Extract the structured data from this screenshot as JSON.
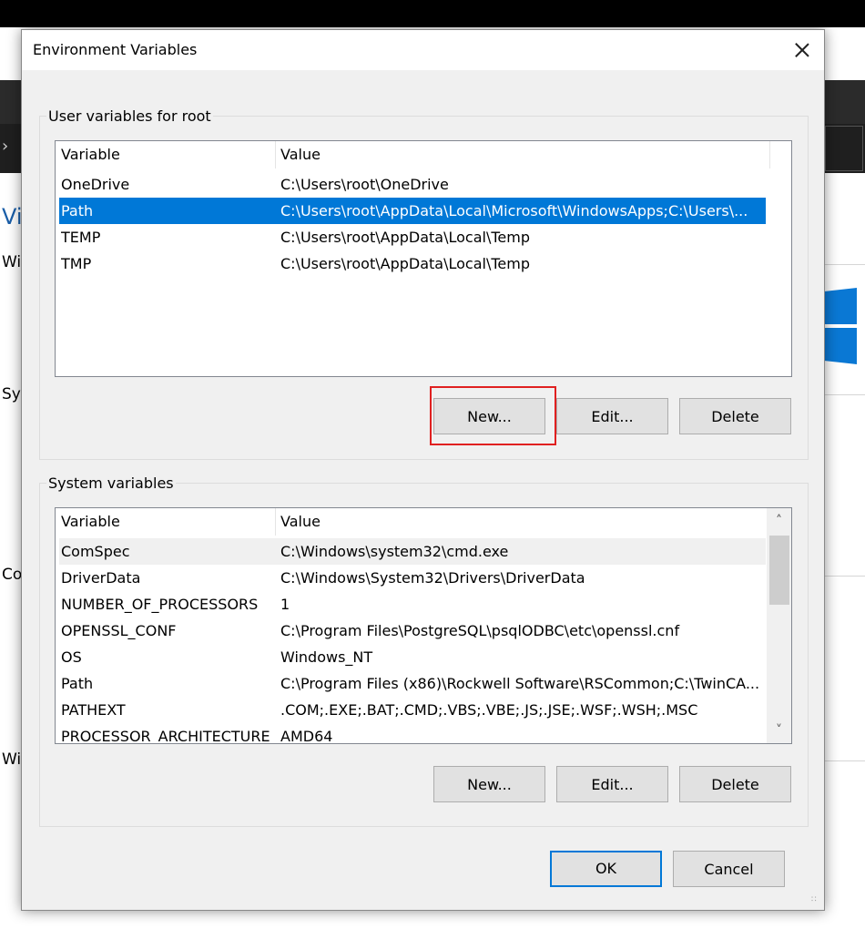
{
  "background": {
    "fragments": [
      "Vi",
      "Wi",
      "Sys",
      "Co",
      "Wi"
    ]
  },
  "dialog": {
    "title": "Environment Variables",
    "user_group": {
      "label": "User variables for root",
      "columns": [
        "Variable",
        "Value"
      ],
      "rows": [
        {
          "variable": "OneDrive",
          "value": "C:\\Users\\root\\OneDrive"
        },
        {
          "variable": "Path",
          "value": "C:\\Users\\root\\AppData\\Local\\Microsoft\\WindowsApps;C:\\Users\\...",
          "selected": true
        },
        {
          "variable": "TEMP",
          "value": "C:\\Users\\root\\AppData\\Local\\Temp"
        },
        {
          "variable": "TMP",
          "value": "C:\\Users\\root\\AppData\\Local\\Temp"
        }
      ],
      "buttons": {
        "new": "New...",
        "edit": "Edit...",
        "delete": "Delete"
      }
    },
    "system_group": {
      "label": "System variables",
      "columns": [
        "Variable",
        "Value"
      ],
      "rows": [
        {
          "variable": "ComSpec",
          "value": "C:\\Windows\\system32\\cmd.exe"
        },
        {
          "variable": "DriverData",
          "value": "C:\\Windows\\System32\\Drivers\\DriverData"
        },
        {
          "variable": "NUMBER_OF_PROCESSORS",
          "value": "1"
        },
        {
          "variable": "OPENSSL_CONF",
          "value": "C:\\Program Files\\PostgreSQL\\psqlODBC\\etc\\openssl.cnf"
        },
        {
          "variable": "OS",
          "value": "Windows_NT"
        },
        {
          "variable": "Path",
          "value": "C:\\Program Files (x86)\\Rockwell Software\\RSCommon;C:\\TwinCA..."
        },
        {
          "variable": "PATHEXT",
          "value": ".COM;.EXE;.BAT;.CMD;.VBS;.VBE;.JS;.JSE;.WSF;.WSH;.MSC"
        },
        {
          "variable": "PROCESSOR_ARCHITECTURE",
          "value": "AMD64"
        }
      ],
      "buttons": {
        "new": "New...",
        "edit": "Edit...",
        "delete": "Delete"
      }
    },
    "footer": {
      "ok": "OK",
      "cancel": "Cancel"
    }
  },
  "colors": {
    "selection": "#0078d7",
    "highlight_box": "#e02020",
    "dialog_bg": "#f0f0f0"
  },
  "icons": [
    "close-icon",
    "scroll-up-icon",
    "scroll-down-icon",
    "resize-grip-icon",
    "chevron-right-icon",
    "windows-logo-icon"
  ]
}
